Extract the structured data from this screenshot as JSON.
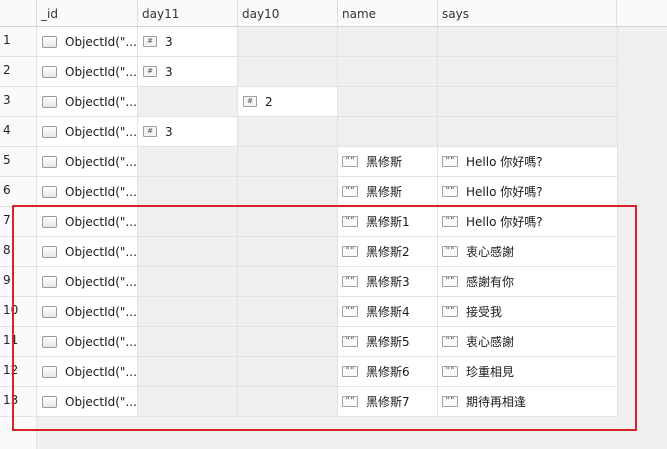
{
  "columns": [
    "_id",
    "day11",
    "day10",
    "name",
    "says"
  ],
  "rows": [
    {
      "n": "1",
      "id": "ObjectId(\"...",
      "day11": "3",
      "day10": "",
      "name": "",
      "says": ""
    },
    {
      "n": "2",
      "id": "ObjectId(\"...",
      "day11": "3",
      "day10": "",
      "name": "",
      "says": ""
    },
    {
      "n": "3",
      "id": "ObjectId(\"...",
      "day11": "",
      "day10": "2",
      "name": "",
      "says": ""
    },
    {
      "n": "4",
      "id": "ObjectId(\"...",
      "day11": "3",
      "day10": "",
      "name": "",
      "says": ""
    },
    {
      "n": "5",
      "id": "ObjectId(\"...",
      "day11": "",
      "day10": "",
      "name": "黑修斯",
      "says": "Hello 你好嗎?"
    },
    {
      "n": "6",
      "id": "ObjectId(\"...",
      "day11": "",
      "day10": "",
      "name": "黑修斯",
      "says": "Hello 你好嗎?"
    },
    {
      "n": "7",
      "id": "ObjectId(\"...",
      "day11": "",
      "day10": "",
      "name": "黑修斯1",
      "says": "Hello 你好嗎?"
    },
    {
      "n": "8",
      "id": "ObjectId(\"...",
      "day11": "",
      "day10": "",
      "name": "黑修斯2",
      "says": "衷心感謝"
    },
    {
      "n": "9",
      "id": "ObjectId(\"...",
      "day11": "",
      "day10": "",
      "name": "黑修斯3",
      "says": "感謝有你"
    },
    {
      "n": "10",
      "id": "ObjectId(\"...",
      "day11": "",
      "day10": "",
      "name": "黑修斯4",
      "says": "接受我"
    },
    {
      "n": "11",
      "id": "ObjectId(\"...",
      "day11": "",
      "day10": "",
      "name": "黑修斯5",
      "says": "衷心感謝"
    },
    {
      "n": "12",
      "id": "ObjectId(\"...",
      "day11": "",
      "day10": "",
      "name": "黑修斯6",
      "says": "珍重相見"
    },
    {
      "n": "13",
      "id": "ObjectId(\"...",
      "day11": "",
      "day10": "",
      "name": "黑修斯7",
      "says": "期待再相逢"
    }
  ],
  "icons": {
    "objectid": "object-icon",
    "number": "#",
    "string": "\"\""
  },
  "colors": {
    "selection_border": "#d8232a",
    "empty_cell": "#f0efed"
  }
}
